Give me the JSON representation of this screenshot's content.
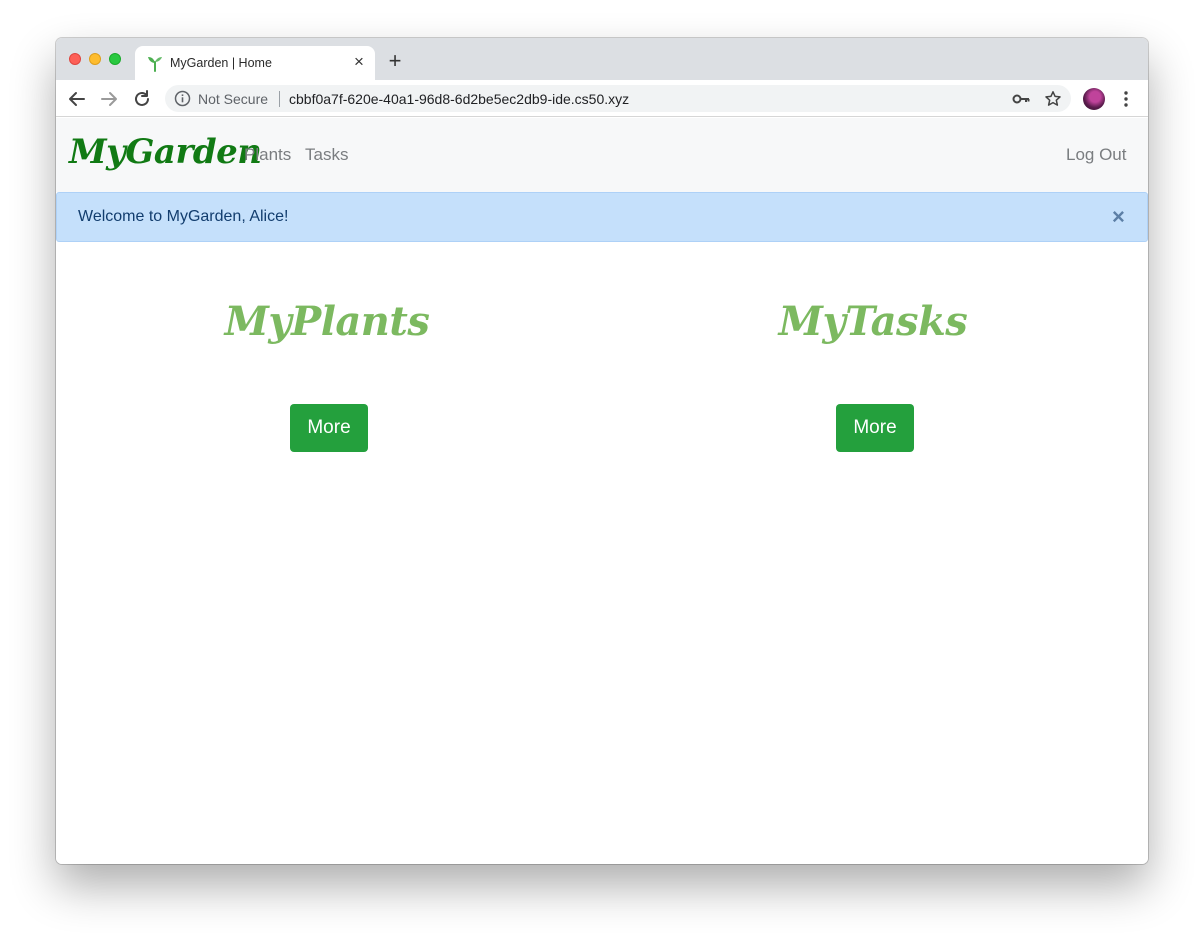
{
  "browser": {
    "tab": {
      "title": "MyGarden | Home",
      "close_symbol": "×",
      "favicon": "sprout-icon"
    },
    "new_tab_symbol": "+",
    "omnibox": {
      "security_label": "Not Secure",
      "url": "cbbf0a7f-620e-40a1-96d8-6d2be5ec2db9-ide.cs50.xyz"
    },
    "icons": [
      "back-icon",
      "forward-icon",
      "reload-icon",
      "info-icon",
      "key-icon",
      "star-icon",
      "avatar",
      "menu-icon"
    ]
  },
  "navbar": {
    "brand": "MyGarden",
    "links": [
      "Plants",
      "Tasks"
    ],
    "logout": "Log Out"
  },
  "alert": {
    "message": "Welcome to MyGarden, Alice!",
    "close_symbol": "×"
  },
  "features": [
    {
      "title": "MyPlants",
      "button": "More"
    },
    {
      "title": "MyTasks",
      "button": "More"
    }
  ],
  "colors": {
    "brand": "#117a14",
    "feature_title": "#7cb960",
    "button": "#24a03d",
    "alert_bg": "#c5e0fb",
    "alert_text": "#123d6e",
    "navbar_bg": "#f7f8f9"
  }
}
